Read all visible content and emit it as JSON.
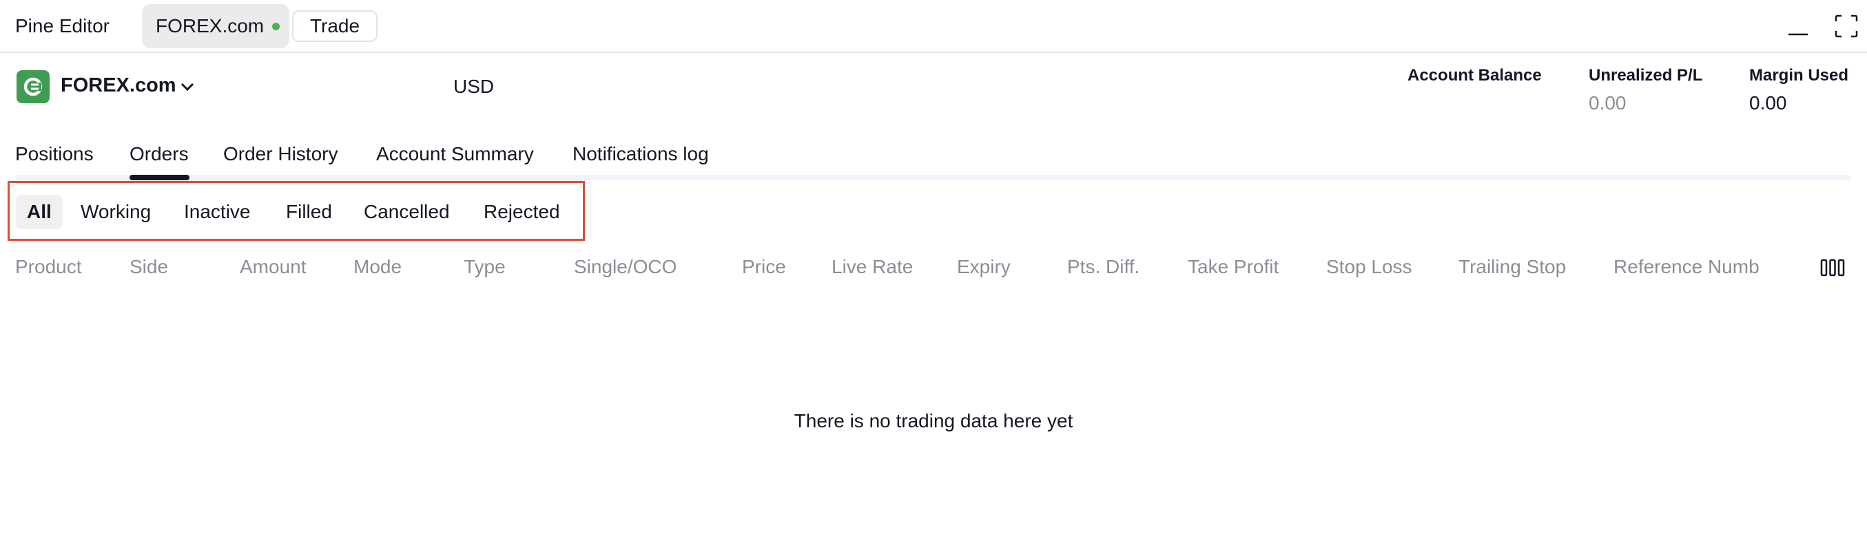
{
  "topbar": {
    "pine_editor": "Pine Editor",
    "broker_tab": "FOREX.com",
    "trade_button": "Trade"
  },
  "broker": {
    "name": "FOREX.com",
    "currency": "USD",
    "metrics": [
      {
        "label": "Account Balance",
        "value": ""
      },
      {
        "label": "Unrealized P/L",
        "value": "0.00"
      },
      {
        "label": "Margin Used",
        "value": "0.00"
      }
    ]
  },
  "tabs": [
    "Positions",
    "Orders",
    "Order History",
    "Account Summary",
    "Notifications log"
  ],
  "active_tab": "Orders",
  "filters": [
    "All",
    "Working",
    "Inactive",
    "Filled",
    "Cancelled",
    "Rejected"
  ],
  "active_filter": "All",
  "columns": [
    "Product",
    "Side",
    "Amount",
    "Mode",
    "Type",
    "Single/OCO",
    "Price",
    "Live Rate",
    "Expiry",
    "Pts. Diff.",
    "Take Profit",
    "Stop Loss",
    "Trailing Stop",
    "Reference Numb"
  ],
  "empty_message": "There is no trading data here yet",
  "colors": {
    "brand_green": "#3f9c53",
    "live_dot": "#4caf50",
    "highlight_border": "#e04b3a",
    "muted_text": "#8a8e96"
  }
}
